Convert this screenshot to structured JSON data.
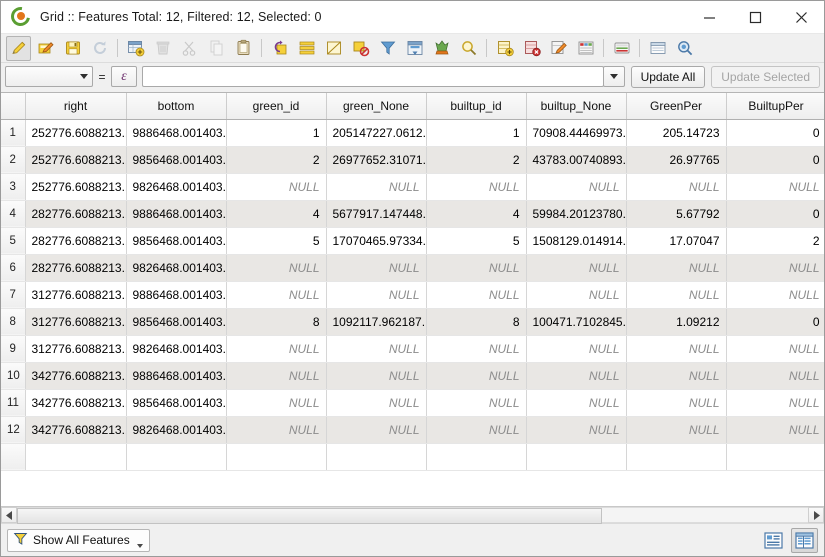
{
  "window": {
    "title": "Grid :: Features Total: 12, Filtered: 12, Selected: 0",
    "logo_icon": "qgis-logo-icon",
    "minimize_label": "—",
    "maximize_label": "□",
    "close_label": "✕"
  },
  "toolbar": {
    "items": [
      {
        "name": "toggle-editing-icon",
        "title": "Toggle editing mode"
      },
      {
        "name": "save-edits-icon",
        "title": "Save edits"
      },
      {
        "name": "save-layer-edits-icon",
        "title": "Save layer edits"
      },
      {
        "name": "reload-table-icon",
        "title": "Reload the table"
      },
      {
        "name": "new-field-icon",
        "title": "New field"
      },
      {
        "name": "delete-field-icon",
        "title": "Delete field"
      },
      {
        "name": "cut-features-icon",
        "title": "Cut features"
      },
      {
        "name": "copy-features-icon",
        "title": "Copy features"
      },
      {
        "name": "paste-features-icon",
        "title": "Paste features"
      },
      {
        "name": "invert-selection-icon",
        "title": "Invert selection"
      },
      {
        "name": "select-all-icon",
        "title": "Select all features"
      },
      {
        "name": "deselect-all-icon",
        "title": "Deselect all features"
      },
      {
        "name": "remove-selection-icon",
        "title": "Remove selection"
      },
      {
        "name": "filter-features-icon",
        "title": "Select features using an expression"
      },
      {
        "name": "move-selection-top-icon",
        "title": "Move selection to top"
      },
      {
        "name": "pan-map-to-selection-icon",
        "title": "Pan map to selected rows"
      },
      {
        "name": "zoom-map-to-selection-icon",
        "title": "Zoom map to selected rows"
      },
      {
        "name": "add-feature-icon",
        "title": "Add feature"
      },
      {
        "name": "delete-feature-icon",
        "title": "Delete selected features"
      },
      {
        "name": "field-calculator-icon",
        "title": "Open field calculator"
      },
      {
        "name": "conditional-formatting-icon",
        "title": "Conditional formatting"
      },
      {
        "name": "organize-columns-icon",
        "title": "Organize columns"
      },
      {
        "name": "actions-icon",
        "title": "Actions"
      },
      {
        "name": "form-view-icon",
        "title": "Switch to form view"
      }
    ]
  },
  "expression_bar": {
    "field_select_value": "",
    "equals_label": "=",
    "expression_button_label": "ε",
    "expression_value": "",
    "expression_placeholder": "",
    "update_all_label": "Update All",
    "update_selected_label": "Update Selected",
    "update_selected_disabled": true
  },
  "table": {
    "row_number_header": "",
    "columns": [
      "right",
      "bottom",
      "green_id",
      "green_None",
      "builtup_id",
      "builtup_None",
      "GreenPer",
      "BuiltupPer"
    ],
    "null_label": "NULL",
    "rows": [
      {
        "n": "1",
        "cells": [
          "252776.6088213...",
          "9886468.001403...",
          "1",
          "205147227.0612...",
          "1",
          "70908.44469973...",
          "205.14723",
          "0"
        ]
      },
      {
        "n": "2",
        "cells": [
          "252776.6088213...",
          "9856468.001403...",
          "2",
          "26977652.31071...",
          "2",
          "43783.00740893...",
          "26.97765",
          "0"
        ]
      },
      {
        "n": "3",
        "cells": [
          "252776.6088213...",
          "9826468.001403...",
          "NULL",
          "NULL",
          "NULL",
          "NULL",
          "NULL",
          "NULL"
        ]
      },
      {
        "n": "4",
        "cells": [
          "282776.6088213...",
          "9886468.001403...",
          "4",
          "5677917.147448...",
          "4",
          "59984.20123780...",
          "5.67792",
          "0"
        ]
      },
      {
        "n": "5",
        "cells": [
          "282776.6088213...",
          "9856468.001403...",
          "5",
          "17070465.97334...",
          "5",
          "1508129.014914...",
          "17.07047",
          "2"
        ]
      },
      {
        "n": "6",
        "cells": [
          "282776.6088213...",
          "9826468.001403...",
          "NULL",
          "NULL",
          "NULL",
          "NULL",
          "NULL",
          "NULL"
        ]
      },
      {
        "n": "7",
        "cells": [
          "312776.6088213...",
          "9886468.001403...",
          "NULL",
          "NULL",
          "NULL",
          "NULL",
          "NULL",
          "NULL"
        ]
      },
      {
        "n": "8",
        "cells": [
          "312776.6088213...",
          "9856468.001403...",
          "8",
          "1092117.962187...",
          "8",
          "100471.7102845...",
          "1.09212",
          "0"
        ]
      },
      {
        "n": "9",
        "cells": [
          "312776.6088213...",
          "9826468.001403...",
          "NULL",
          "NULL",
          "NULL",
          "NULL",
          "NULL",
          "NULL"
        ]
      },
      {
        "n": "10",
        "cells": [
          "342776.6088213...",
          "9886468.001403...",
          "NULL",
          "NULL",
          "NULL",
          "NULL",
          "NULL",
          "NULL"
        ]
      },
      {
        "n": "11",
        "cells": [
          "342776.6088213...",
          "9856468.001403...",
          "NULL",
          "NULL",
          "NULL",
          "NULL",
          "NULL",
          "NULL"
        ]
      },
      {
        "n": "12",
        "cells": [
          "342776.6088213...",
          "9826468.001403...",
          "NULL",
          "NULL",
          "NULL",
          "NULL",
          "NULL",
          "NULL"
        ]
      }
    ]
  },
  "statusbar": {
    "filter_button_label": "Show All Features",
    "filter_icon": "funnel-icon",
    "form_view_icon": "form-view-icon",
    "table_view_icon": "table-view-icon",
    "table_view_active": true
  },
  "colors": {
    "accent_green": "#5a9e32",
    "accent_orange": "#e2761b",
    "icon_yellow": "#f2d13c",
    "icon_red": "#cc3333",
    "null_text": "#8c8c8c",
    "alt_row": "#e9e7e4"
  }
}
